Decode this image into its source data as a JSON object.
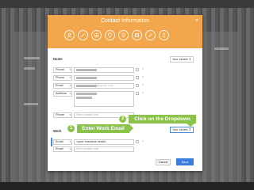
{
  "dialog": {
    "title": "Contact Information",
    "close_label": "×",
    "header_icons": [
      "person-icon",
      "pencil-icon",
      "globe-icon",
      "location-icon",
      "bulb-icon",
      "calendar-icon",
      "tools-icon",
      "phone-icon"
    ]
  },
  "home": {
    "label": "Home",
    "visibility": "Your circles",
    "rows": [
      {
        "type": "Phone",
        "value": "",
        "tail": ""
      },
      {
        "type": "Phone",
        "value": "",
        "tail": ""
      },
      {
        "type": "Email",
        "value": "",
        "tail": "@gmail.com"
      },
      {
        "type": "Address",
        "value": "",
        "tail": ""
      }
    ],
    "new_row": {
      "type": "Phone",
      "placeholder": "New contact info"
    }
  },
  "work": {
    "label": "Work",
    "visibility": "Your circles",
    "rows": [
      {
        "type": "Email",
        "value": "<your business email>"
      }
    ],
    "new_row": {
      "type": "Email",
      "placeholder": "New contact info"
    }
  },
  "buttons": {
    "cancel": "Cancel",
    "save": "Save"
  },
  "callouts": {
    "step1": {
      "number": "1",
      "text": "Enter Work Email"
    },
    "step2": {
      "number": "2",
      "text": "Click on the Dropdown"
    }
  },
  "colors": {
    "header": "#f2a74c",
    "callout": "#8bc34a",
    "save": "#3b7ddd"
  }
}
